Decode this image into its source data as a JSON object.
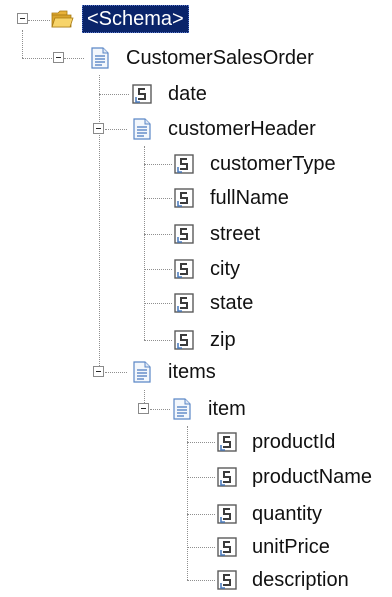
{
  "tree": {
    "root": {
      "label": "<Schema>",
      "icon": "folder-open-icon",
      "expanded": true,
      "selected": true
    },
    "order": {
      "label": "CustomerSalesOrder",
      "icon": "record-icon",
      "expanded": true
    },
    "date": {
      "label": "date",
      "icon": "field-icon"
    },
    "customer_header": {
      "label": "customerHeader",
      "icon": "record-icon",
      "expanded": true
    },
    "customer_type": {
      "label": "customerType",
      "icon": "field-icon"
    },
    "full_name": {
      "label": "fullName",
      "icon": "field-icon"
    },
    "street": {
      "label": "street",
      "icon": "field-icon"
    },
    "city": {
      "label": "city",
      "icon": "field-icon"
    },
    "state": {
      "label": "state",
      "icon": "field-icon"
    },
    "zip": {
      "label": "zip",
      "icon": "field-icon"
    },
    "items": {
      "label": "items",
      "icon": "record-icon",
      "expanded": true
    },
    "item": {
      "label": "item",
      "icon": "record-icon",
      "expanded": true
    },
    "product_id": {
      "label": "productId",
      "icon": "field-icon"
    },
    "product_name": {
      "label": "productName",
      "icon": "field-icon"
    },
    "quantity": {
      "label": "quantity",
      "icon": "field-icon"
    },
    "unit_price": {
      "label": "unitPrice",
      "icon": "field-icon"
    },
    "description": {
      "label": "description",
      "icon": "field-icon"
    }
  },
  "colors": {
    "selection": "#0a246a",
    "folder": "#f2c447",
    "record": "#5b87c6",
    "field": "#6a6a6a"
  }
}
